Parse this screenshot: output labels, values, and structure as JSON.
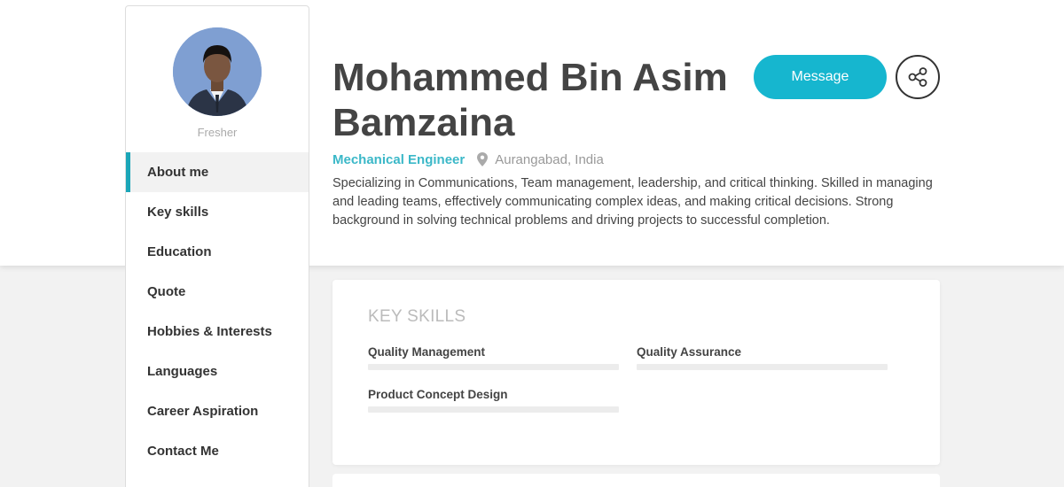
{
  "profile": {
    "name": "Mohammed Bin Asim Bamzaina",
    "level": "Fresher",
    "job_title": "Mechanical Engineer",
    "location": "Aurangabad, India",
    "summary": "Specializing in Communications, Team management, leadership, and critical thinking. Skilled in managing and leading teams, effectively communicating complex ideas, and making critical decisions. Strong background in solving technical problems and driving projects to successful completion."
  },
  "actions": {
    "message_label": "Message",
    "share_icon": "share-icon",
    "location_icon": "map-pin-icon"
  },
  "nav": {
    "items": [
      {
        "label": "About me",
        "active": true
      },
      {
        "label": "Key skills"
      },
      {
        "label": "Education"
      },
      {
        "label": "Quote"
      },
      {
        "label": "Hobbies & Interests"
      },
      {
        "label": "Languages"
      },
      {
        "label": "Career Aspiration"
      },
      {
        "label": "Contact Me"
      }
    ]
  },
  "key_skills": {
    "title": "KEY SKILLS",
    "skills": [
      {
        "name": "Quality Management",
        "level": 0
      },
      {
        "name": "Quality Assurance",
        "level": 0
      },
      {
        "name": "Product Concept Design",
        "level": 0
      }
    ]
  },
  "colors": {
    "accent": "#16b6cf",
    "job_title": "#3bb8c8",
    "text": "#444444",
    "muted": "#999999"
  }
}
